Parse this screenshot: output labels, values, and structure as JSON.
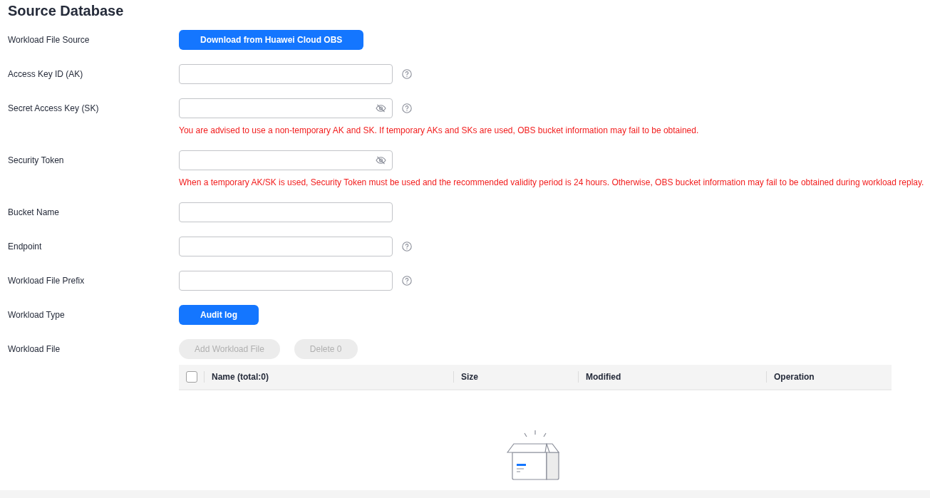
{
  "title": "Source Database",
  "fields": [
    {
      "label": "Workload File Source",
      "kind": "button",
      "button": "Download from Huawei Cloud OBS"
    },
    {
      "label": "Access Key ID (AK)",
      "kind": "text",
      "help": true
    },
    {
      "label": "Secret Access Key (SK)",
      "kind": "secret",
      "help": true,
      "warning": "You are advised to use a non-temporary AK and SK. If temporary AKs and SKs are used, OBS bucket information may fail to be obtained."
    },
    {
      "label": "Security Token",
      "kind": "secret",
      "help": false,
      "warning": "When a temporary AK/SK is used, Security Token must be used and the recommended validity period is 24 hours. Otherwise, OBS bucket information may fail to be obtained during workload replay."
    },
    {
      "label": "Bucket Name",
      "kind": "text",
      "help": false
    },
    {
      "label": "Endpoint",
      "kind": "text",
      "help": true
    },
    {
      "label": "Workload File Prefix",
      "kind": "text",
      "help": true
    },
    {
      "label": "Workload Type",
      "kind": "button",
      "button": "Audit log"
    },
    {
      "label": "Workload File",
      "kind": "files"
    }
  ],
  "file_actions": [
    {
      "label": "Add Workload File",
      "disabled": true
    },
    {
      "label": "Delete 0",
      "disabled": true
    }
  ],
  "table": {
    "select_all_checked": false,
    "columns": [
      "Name (total:0)",
      "Size",
      "Modified",
      "Operation"
    ]
  }
}
